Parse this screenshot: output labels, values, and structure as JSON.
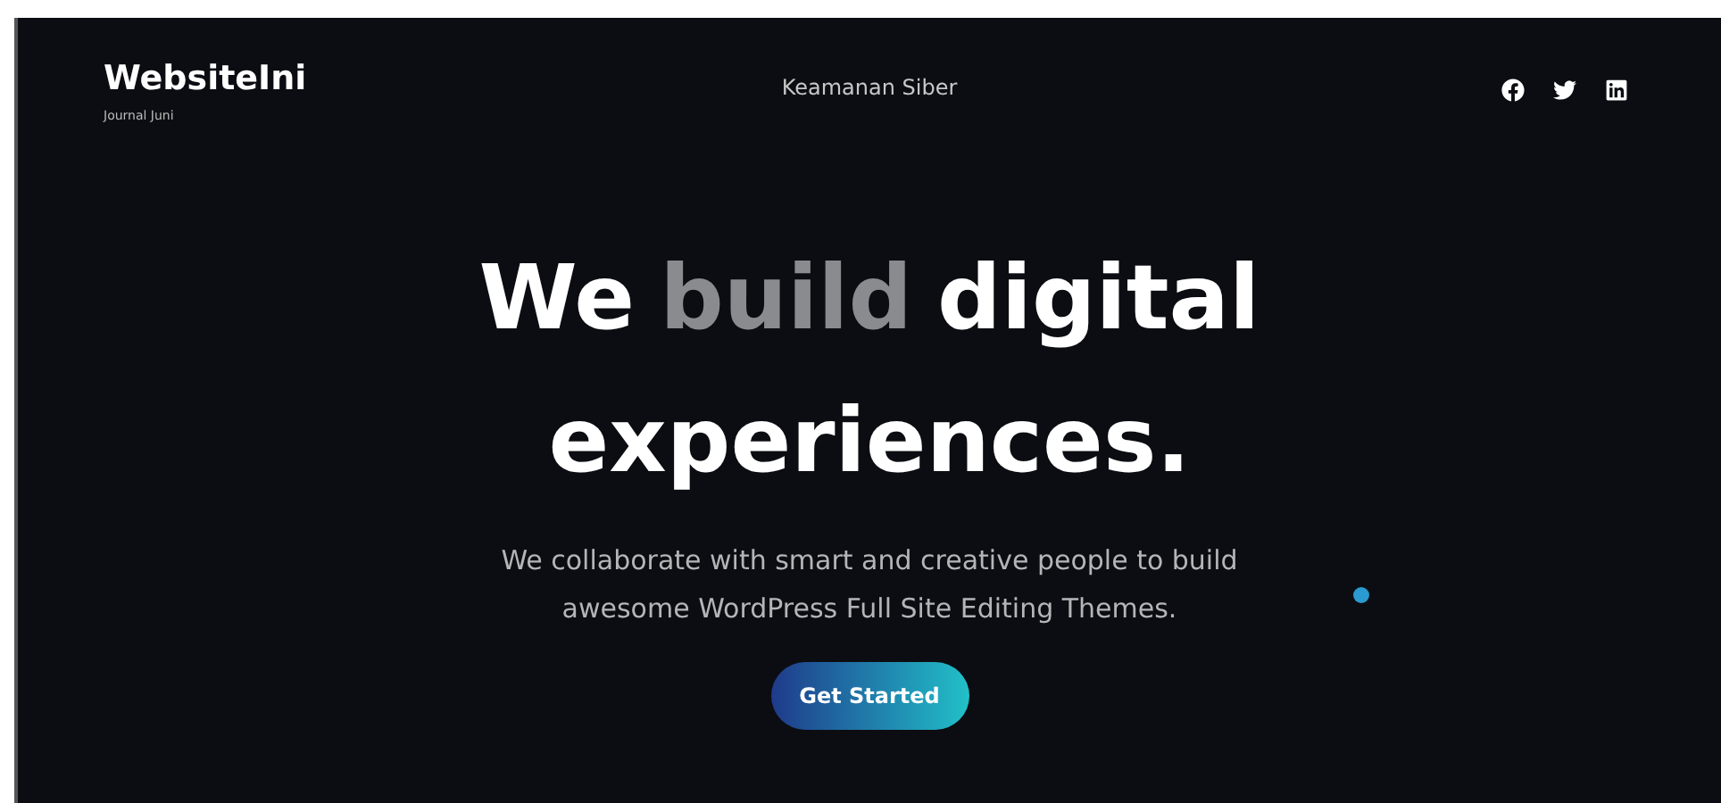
{
  "site": {
    "title": "WebsiteIni",
    "tagline": "Journal Juni"
  },
  "nav": {
    "items": [
      "Keamanan Siber"
    ]
  },
  "social": [
    {
      "kind": "facebook"
    },
    {
      "kind": "twitter"
    },
    {
      "kind": "linkedin"
    }
  ],
  "hero": {
    "headline_line_1": [
      {
        "text": "We",
        "muted": false
      },
      {
        "text": "build",
        "muted": true
      },
      {
        "text": "digital",
        "muted": false
      }
    ],
    "headline_line_2": "experiences.",
    "description_line_1": "We collaborate with smart and creative people to build",
    "description_line_2": "awesome WordPress Full Site Editing Themes.",
    "button": "Get Started"
  }
}
